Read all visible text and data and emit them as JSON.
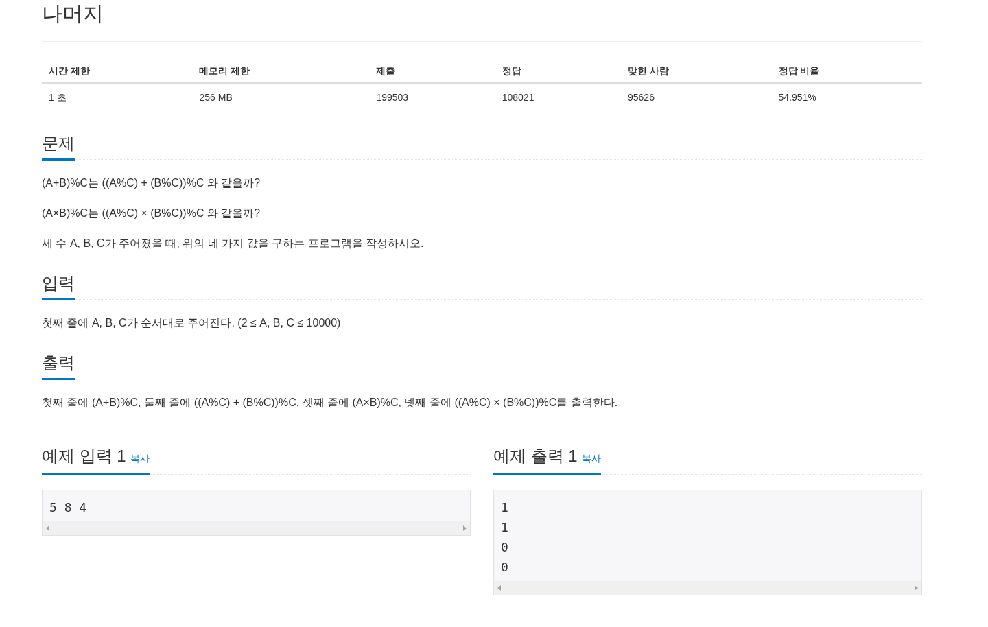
{
  "title": "나머지",
  "info_table": {
    "columns": [
      "시간 제한",
      "메모리 제한",
      "제출",
      "정답",
      "맞힌 사람",
      "정답 비율"
    ],
    "rows": [
      [
        "1 초",
        "256 MB",
        "199503",
        "108021",
        "95626",
        "54.951%"
      ]
    ]
  },
  "sections": [
    {
      "heading": "문제",
      "paragraphs": [
        "(A+B)%C는 ((A%C) + (B%C))%C 와 같을까?",
        "(A×B)%C는 ((A%C) × (B%C))%C 와 같을까?",
        "세 수 A, B, C가 주어졌을 때, 위의 네 가지 값을 구하는 프로그램을 작성하시오."
      ]
    },
    {
      "heading": "입력",
      "paragraphs": [
        "첫째 줄에 A, B, C가 순서대로 주어진다. (2 ≤ A, B, C ≤ 10000)"
      ]
    },
    {
      "heading": "출력",
      "paragraphs": [
        "첫째 줄에 (A+B)%C, 둘째 줄에 ((A%C) + (B%C))%C, 셋째 줄에 (A×B)%C, 넷째 줄에 ((A%C) × (B%C))%C를 출력한다."
      ]
    }
  ],
  "samples": [
    {
      "heading": "예제 입력 1",
      "copy_link": "복사",
      "content": "5 8 4"
    },
    {
      "heading": "예제 출력 1",
      "copy_link": "복사",
      "content": "1\n1\n0\n0"
    }
  ]
}
